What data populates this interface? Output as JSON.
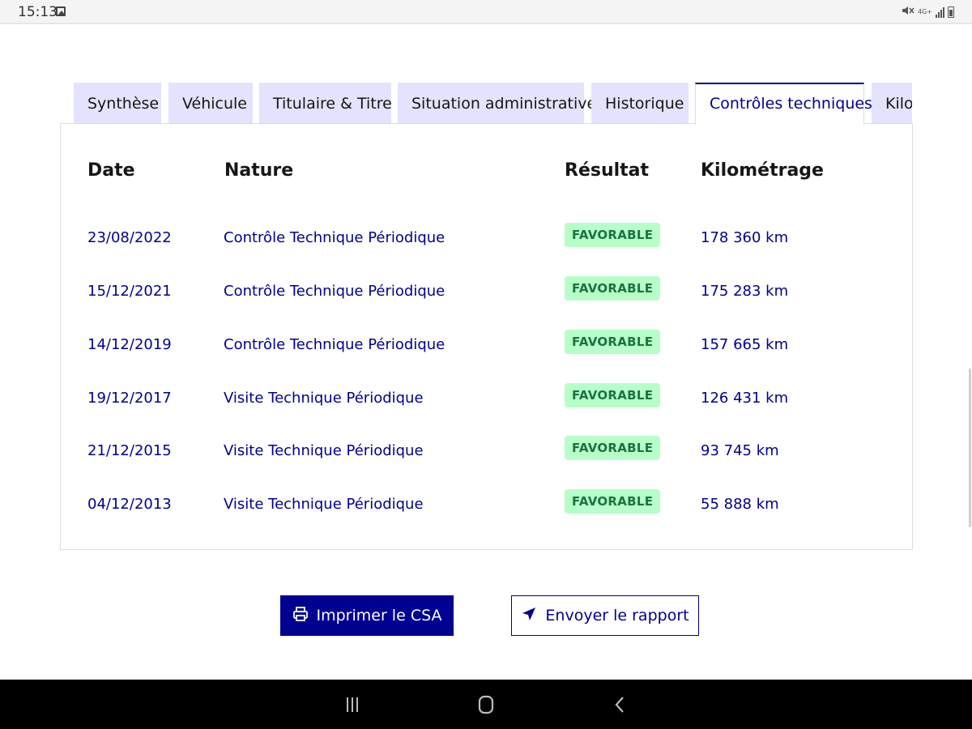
{
  "status_bar": {
    "time": "15:13",
    "network": "4G+"
  },
  "tabs": [
    {
      "label": "Synthèse",
      "active": false
    },
    {
      "label": "Véhicule",
      "active": false
    },
    {
      "label": "Titulaire & Titre",
      "active": false
    },
    {
      "label": "Situation administrative",
      "active": false
    },
    {
      "label": "Historique",
      "active": false
    },
    {
      "label": "Contrôles techniques",
      "active": true
    },
    {
      "label": "Kilo",
      "active": false
    }
  ],
  "table": {
    "headers": [
      "Date",
      "Nature",
      "Résultat",
      "Kilométrage"
    ],
    "rows": [
      {
        "date": "23/08/2022",
        "nature": "Contrôle Technique Périodique",
        "result": "FAVORABLE",
        "mileage": "178 360 km"
      },
      {
        "date": "15/12/2021",
        "nature": "Contrôle Technique Périodique",
        "result": "FAVORABLE",
        "mileage": "175 283 km"
      },
      {
        "date": "14/12/2019",
        "nature": "Contrôle Technique Périodique",
        "result": "FAVORABLE",
        "mileage": "157 665 km"
      },
      {
        "date": "19/12/2017",
        "nature": "Visite Technique Périodique",
        "result": "FAVORABLE",
        "mileage": "126 431 km"
      },
      {
        "date": "21/12/2015",
        "nature": "Visite Technique Périodique",
        "result": "FAVORABLE",
        "mileage": "93 745 km"
      },
      {
        "date": "04/12/2013",
        "nature": "Visite Technique Périodique",
        "result": "FAVORABLE",
        "mileage": "55 888 km"
      }
    ]
  },
  "actions": {
    "print_label": "Imprimer le CSA",
    "send_label": "Envoyer le rapport"
  },
  "colors": {
    "primary": "#000091",
    "tab_bg": "#e3e3fd",
    "badge_bg": "#b8fec9",
    "badge_text": "#18753c"
  },
  "icons": {
    "print": "printer-icon",
    "send": "send-icon",
    "nav_recent": "recent-apps-icon",
    "nav_home": "home-icon",
    "nav_back": "back-icon"
  }
}
